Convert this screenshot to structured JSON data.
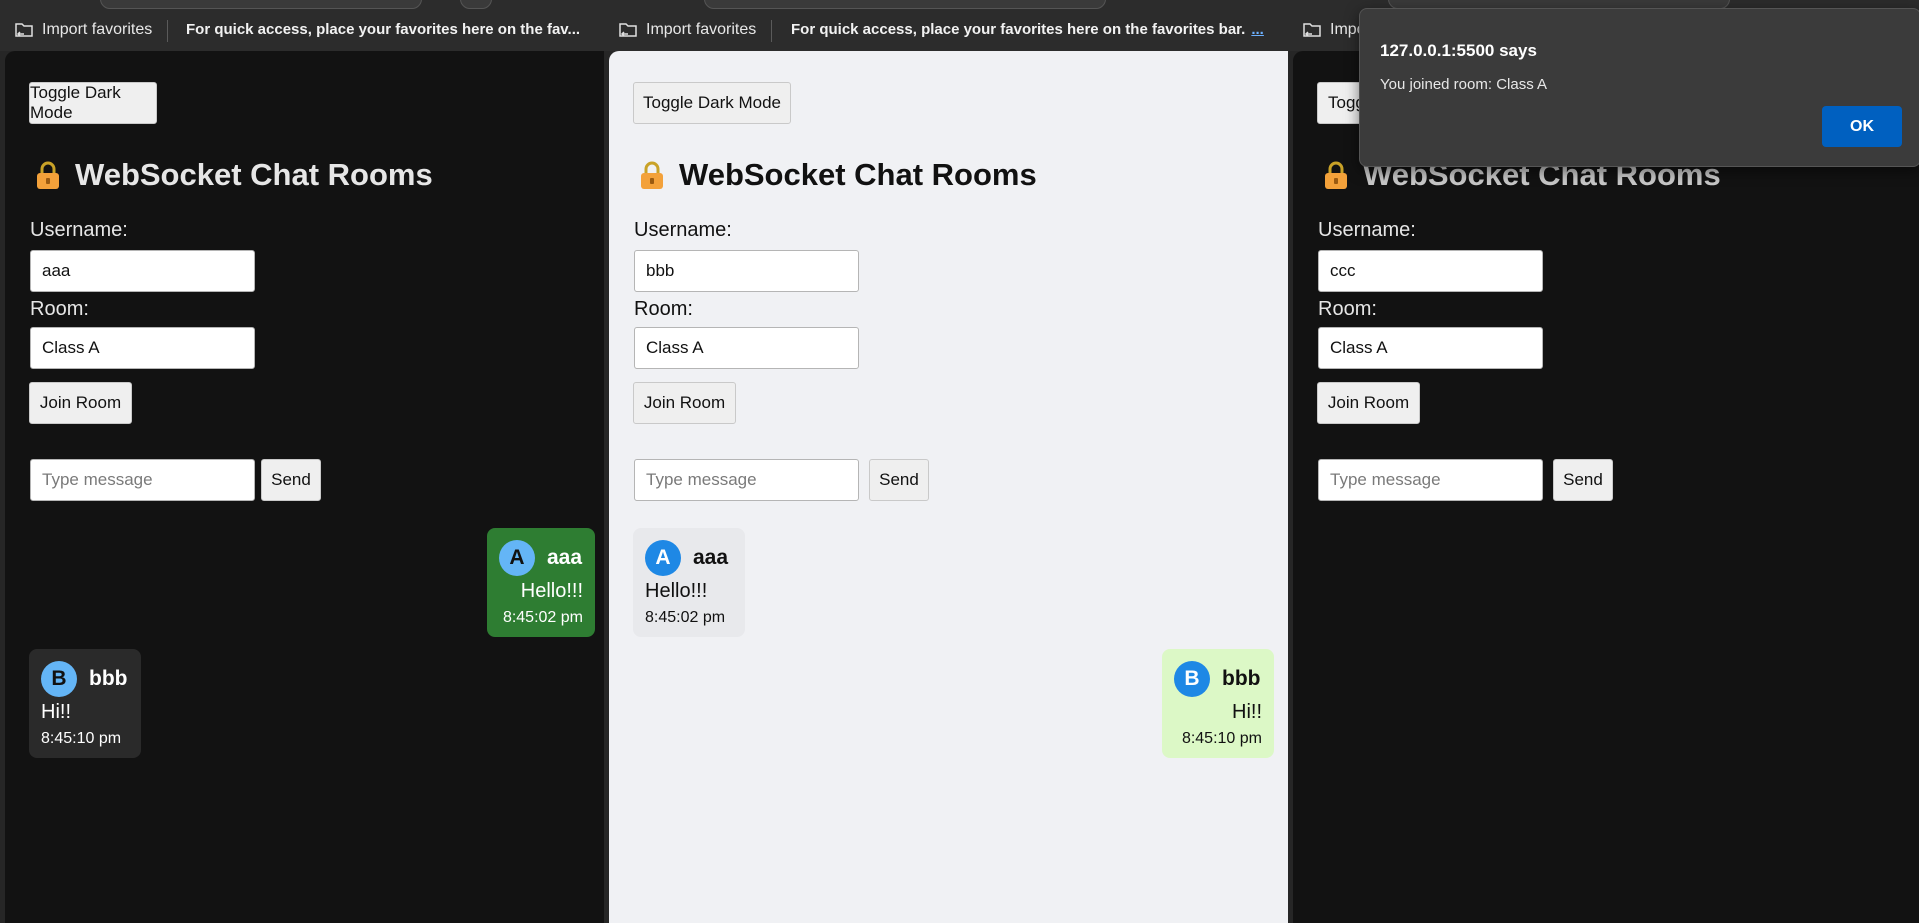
{
  "favorites_bar": {
    "import_label": "Import favorites",
    "hint_truncated": "For quick access, place your favorites here on the fav...",
    "hint_full": "For quick access, place your favorites here on the favorites bar.",
    "more_label": "...",
    "import_label_clipped": "Impo"
  },
  "app": {
    "toggle_label": "Toggle Dark Mode",
    "title": "WebSocket Chat Rooms",
    "username_label": "Username:",
    "room_label": "Room:",
    "join_label": "Join Room",
    "message_placeholder": "Type message",
    "send_label": "Send",
    "toggle_label_clipped": "Togg"
  },
  "windows": [
    {
      "theme": "dark",
      "username": "aaa",
      "room": "Class A",
      "messages": [
        {
          "initial": "A",
          "user": "aaa",
          "text": "Hello!!!",
          "time": "8:45:02 pm"
        },
        {
          "initial": "B",
          "user": "bbb",
          "text": "Hi!!",
          "time": "8:45:10 pm"
        }
      ]
    },
    {
      "theme": "light",
      "username": "bbb",
      "room": "Class A",
      "messages": [
        {
          "initial": "A",
          "user": "aaa",
          "text": "Hello!!!",
          "time": "8:45:02 pm"
        },
        {
          "initial": "B",
          "user": "bbb",
          "text": "Hi!!",
          "time": "8:45:10 pm"
        }
      ]
    },
    {
      "theme": "dark",
      "username": "ccc",
      "room": "Class A",
      "messages": []
    }
  ],
  "dialog": {
    "title": "127.0.0.1:5500 says",
    "message": "You joined room: Class A",
    "ok_label": "OK"
  },
  "colors": {
    "dark_bg": "#121212",
    "light_bg": "#f0f1f4",
    "own_msg_dark": "#2e7d32",
    "other_msg_dark": "#2a2a2a",
    "own_msg_light": "#dcf8c6",
    "other_msg_light": "#e8e9ec",
    "avatar_dark": "#64b5f6",
    "avatar_light": "#1e88e5",
    "dialog_ok": "#0060c0"
  }
}
